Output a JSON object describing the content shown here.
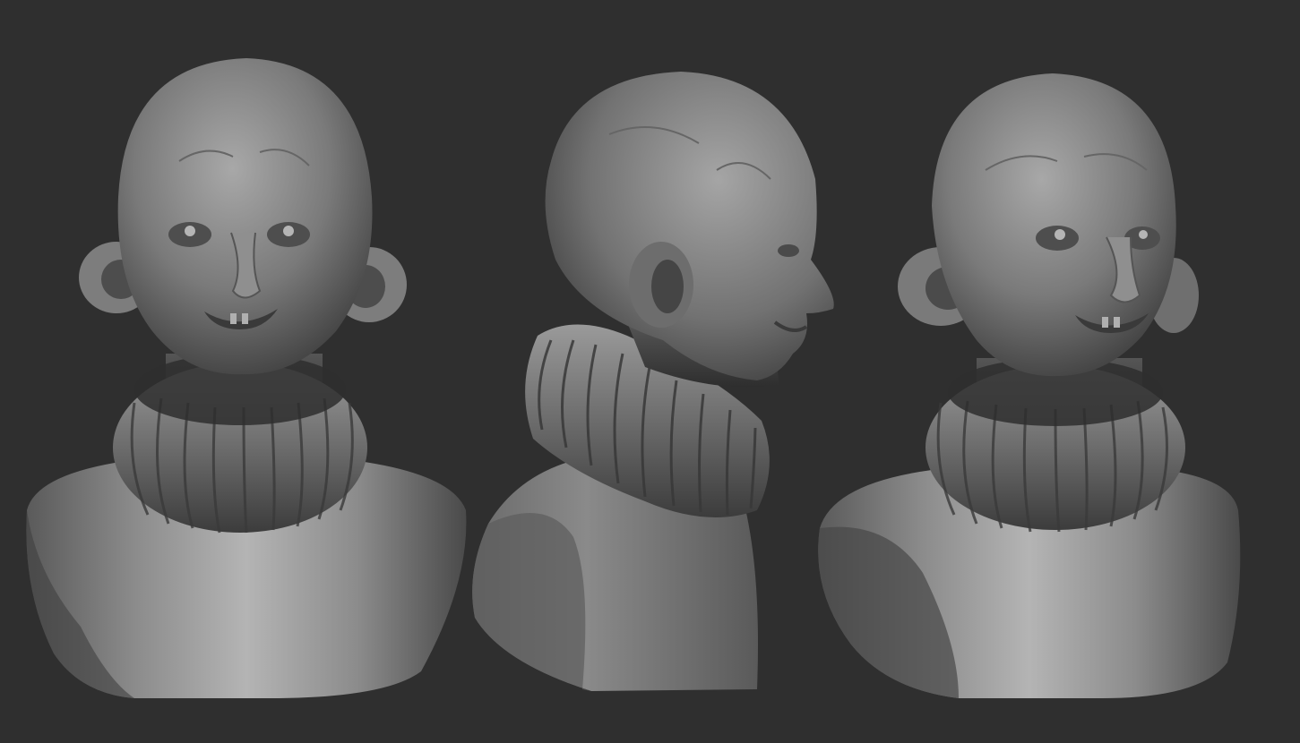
{
  "scene": {
    "background_color": "#2f2f2f",
    "clay_color": "#8a8a8a",
    "views": [
      {
        "id": "front",
        "subject": "bust-front-view"
      },
      {
        "id": "side",
        "subject": "bust-side-view"
      },
      {
        "id": "three-quarter",
        "subject": "bust-three-quarter-view"
      }
    ]
  }
}
